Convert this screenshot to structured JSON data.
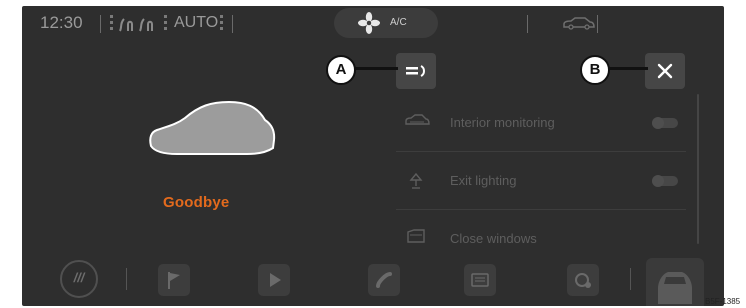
{
  "statusbar": {
    "time": "12:30",
    "mode": "AUTO",
    "ac_label": "A/C",
    "icons": [
      "seat-heating-icon",
      "fan-icon",
      "car-icon"
    ]
  },
  "main": {
    "message": "Goodbye",
    "accent_color": "#e36a1d"
  },
  "buttons": {
    "a_icon": "light-menu-icon",
    "b_icon": "close-icon"
  },
  "settings": [
    {
      "label": "Interior monitoring",
      "icon": "car-monitor-icon"
    },
    {
      "label": "Exit lighting",
      "icon": "lamp-icon"
    },
    {
      "label": "Close windows",
      "icon": "window-icon"
    }
  ],
  "dock": {
    "menu_label": "///",
    "icons": [
      "menu-icon",
      "flag-icon",
      "play-icon",
      "phone-icon",
      "radio-icon",
      "settings-icon",
      "car-icon"
    ]
  },
  "callouts": {
    "a": "A",
    "b": "B"
  },
  "figure_code": "B5F-1385"
}
